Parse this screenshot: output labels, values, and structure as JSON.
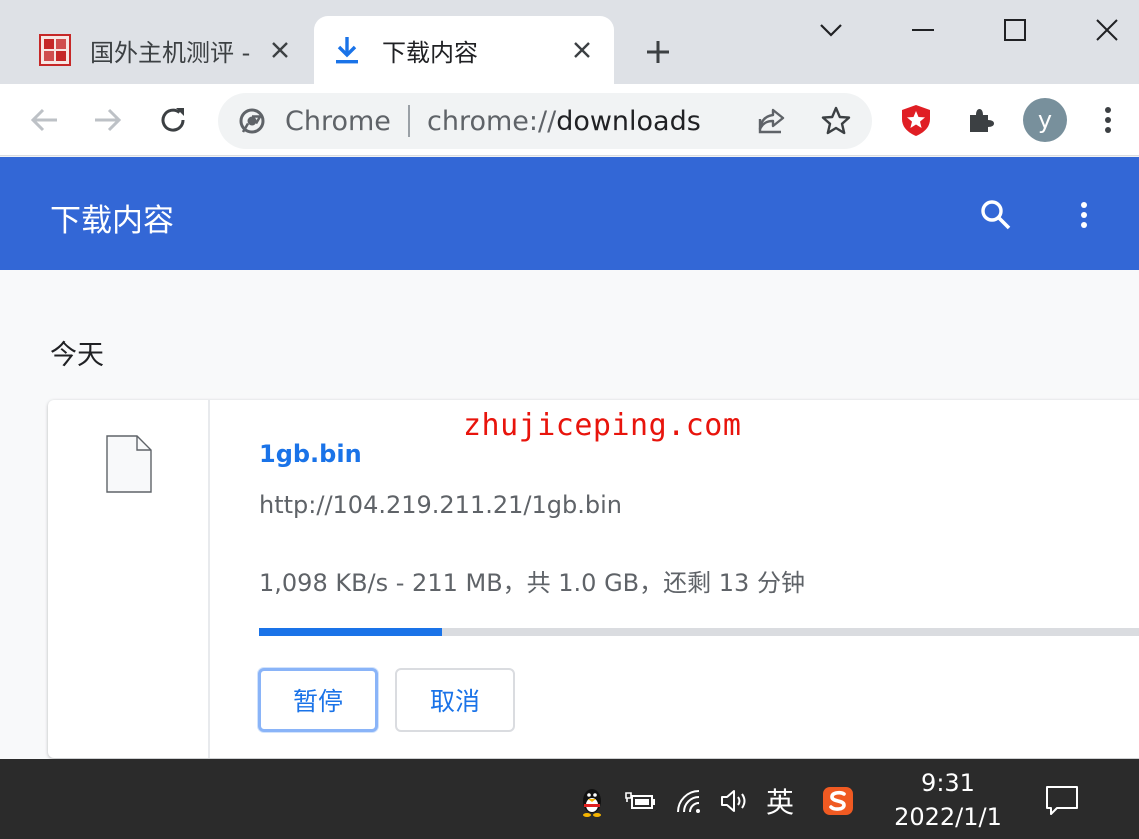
{
  "tabs": [
    {
      "title": "国外主机测评 - ",
      "active": false,
      "favicon": "site-seal-icon"
    },
    {
      "title": "下载内容",
      "active": true,
      "favicon": "download-icon"
    }
  ],
  "toolbar": {
    "omnibox_chip": "Chrome",
    "url_scheme": "chrome://",
    "url_host": "downloads"
  },
  "profile": {
    "initial": "y"
  },
  "page": {
    "title": "下载内容"
  },
  "downloads": {
    "section_label": "今天",
    "items": [
      {
        "file_name": "1gb.bin",
        "url": "http://104.219.211.21/1gb.bin",
        "status": "1,098 KB/s - 211 MB，共 1.0 GB，还剩 13 分钟",
        "progress": 0.206,
        "pause_label": "暂停",
        "cancel_label": "取消"
      }
    ]
  },
  "watermark": "zhujiceping.com",
  "taskbar": {
    "ime": "英",
    "time": "9:31",
    "date": "2022/1/1"
  },
  "colors": {
    "accent": "#3367d6",
    "link": "#1a73e8",
    "watermark": "#e8140c"
  }
}
